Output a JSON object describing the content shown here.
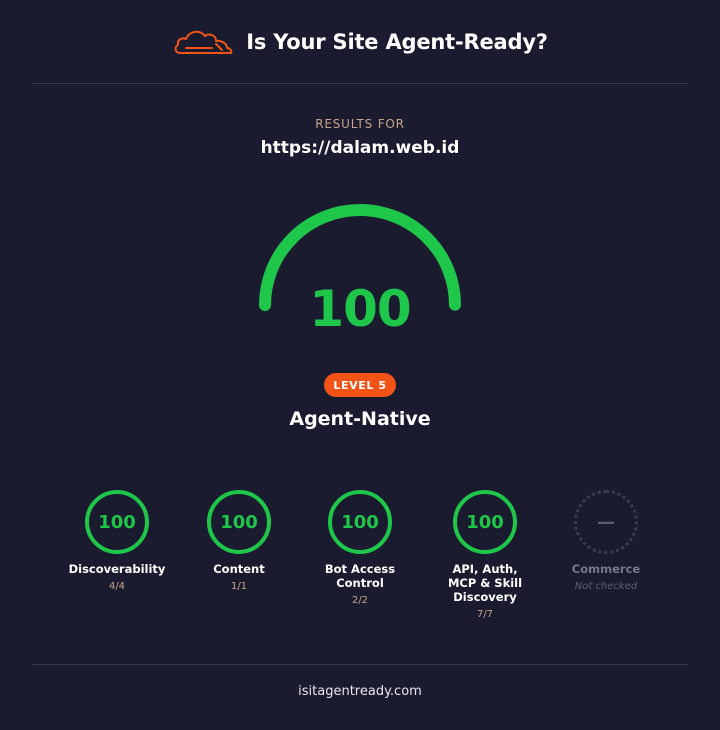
{
  "header": {
    "title": "Is Your Site Agent-Ready?",
    "logo_icon": "cloudflare-cloud-icon",
    "logo_color": "#f25418"
  },
  "results": {
    "label": "RESULTS FOR",
    "url": "https://dalam.web.id"
  },
  "score": {
    "value": "100",
    "fraction": 1.0,
    "color": "#1ec64a"
  },
  "level": {
    "badge": "LEVEL 5",
    "name": "Agent-Native",
    "badge_color": "#f25418"
  },
  "categories": [
    {
      "score": "100",
      "name": "Discoverability",
      "detail": "4/4",
      "checked": true
    },
    {
      "score": "100",
      "name": "Content",
      "detail": "1/1",
      "checked": true
    },
    {
      "score": "100",
      "name": "Bot Access Control",
      "detail": "2/2",
      "checked": true
    },
    {
      "score": "100",
      "name": "API, Auth, MCP & Skill Discovery",
      "detail": "7/7",
      "checked": true
    },
    {
      "score": "—",
      "name": "Commerce",
      "detail": "Not checked",
      "checked": false
    }
  ],
  "footer": {
    "text": "isitagentready.com"
  }
}
